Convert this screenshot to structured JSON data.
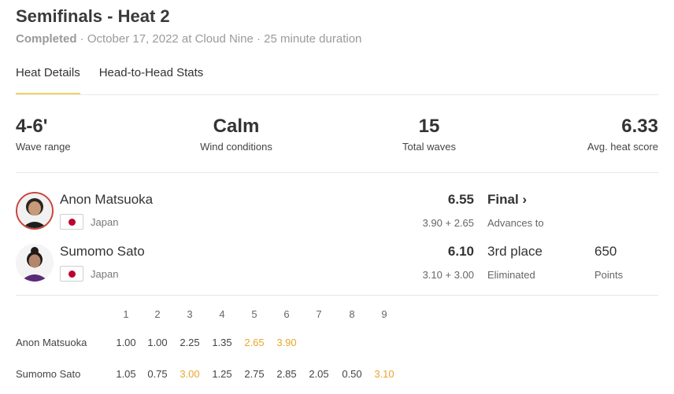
{
  "header": {
    "title": "Semifinals - Heat 2",
    "status": "Completed",
    "details": " · October 17, 2022 at Cloud Nine · 25 minute duration"
  },
  "tabs": [
    {
      "label": "Heat Details",
      "active": true
    },
    {
      "label": "Head-to-Head Stats",
      "active": false
    }
  ],
  "stats": [
    {
      "value": "4-6'",
      "label": "Wave range"
    },
    {
      "value": "Calm",
      "label": "Wind conditions"
    },
    {
      "value": "15",
      "label": "Total waves"
    },
    {
      "value": "6.33",
      "label": "Avg. heat score"
    }
  ],
  "surfers": [
    {
      "name": "Anon Matsuoka",
      "country": "Japan",
      "score": "6.55",
      "breakdown": "3.90 + 2.65",
      "result": "Final ›",
      "result_sub": "Advances to",
      "points": "",
      "points_label": ""
    },
    {
      "name": "Sumomo Sato",
      "country": "Japan",
      "score": "6.10",
      "breakdown": "3.10 + 3.00",
      "result": "3rd place",
      "result_sub": "Eliminated",
      "points": "650",
      "points_label": "Points"
    }
  ],
  "waves": {
    "columns": [
      "1",
      "2",
      "3",
      "4",
      "5",
      "6",
      "7",
      "8",
      "9"
    ],
    "rows": [
      {
        "name": "Anon Matsuoka",
        "scores": [
          "1.00",
          "1.00",
          "2.25",
          "1.35",
          "2.65",
          "3.90",
          "",
          "",
          ""
        ],
        "highlight": [
          4,
          5
        ]
      },
      {
        "name": "Sumomo Sato",
        "scores": [
          "1.05",
          "0.75",
          "3.00",
          "1.25",
          "2.75",
          "2.85",
          "2.05",
          "0.50",
          "3.10"
        ],
        "highlight": [
          2,
          8
        ]
      }
    ],
    "highlight_color": "#e8a72a"
  },
  "colors": {
    "accent_underline": "#f4d26b",
    "avatar_ring": "#c9463d",
    "flag_red": "#bc002d"
  }
}
